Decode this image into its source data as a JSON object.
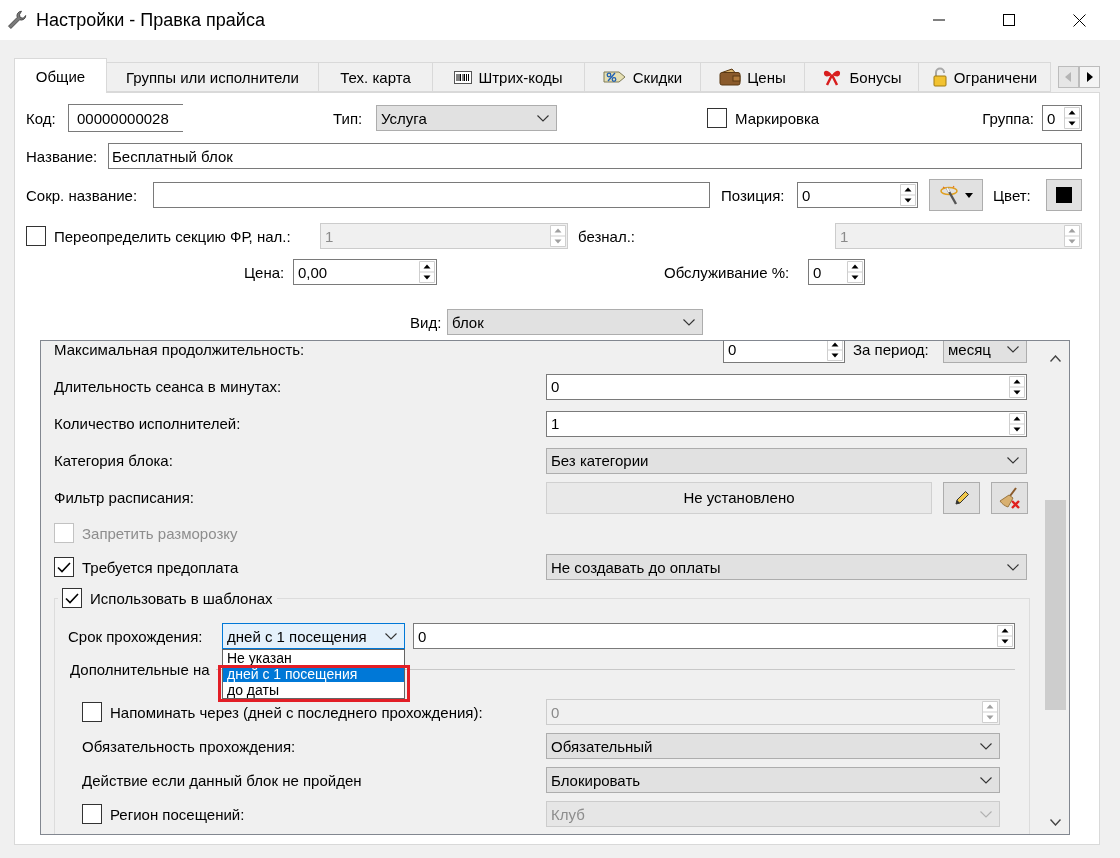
{
  "window": {
    "title": "Настройки - Правка прайса"
  },
  "tabs": [
    {
      "label": "Общие",
      "selected": true
    },
    {
      "label": "Группы или исполнители",
      "selected": false
    },
    {
      "label": "Тех. карта",
      "selected": false
    },
    {
      "label": "Штрих-коды",
      "selected": false
    },
    {
      "label": "Скидки",
      "selected": false
    },
    {
      "label": "Цены",
      "selected": false
    },
    {
      "label": "Бонусы",
      "selected": false
    },
    {
      "label": "Ограничени",
      "selected": false
    }
  ],
  "tab_scroll": {
    "back_disabled": true,
    "forward_disabled": false
  },
  "general": {
    "code": {
      "label": "Код:",
      "value": "00000000028"
    },
    "type": {
      "label": "Тип:",
      "value": "Услуга"
    },
    "marking": {
      "label": "Маркировка",
      "checked": false
    },
    "group": {
      "label": "Группа:",
      "value": "0"
    },
    "name": {
      "label": "Название:",
      "value": "Бесплатный блок"
    },
    "short_name": {
      "label": "Сокр. название:"
    },
    "position": {
      "label": "Позиция:",
      "value": "0"
    },
    "color": {
      "label": "Цвет:",
      "color": "#000000"
    },
    "override_fr": {
      "label": "Переопределить секцию ФР, нал.:",
      "checked": false,
      "value": "1",
      "disabled": true
    },
    "cashless": {
      "label": "безнал.:",
      "value": "1",
      "disabled": true
    },
    "price": {
      "label": "Цена:",
      "value": "0,00"
    },
    "service": {
      "label": "Обслуживание %:",
      "value": "0"
    },
    "view": {
      "label": "Вид:",
      "value": "блок"
    }
  },
  "block": {
    "rows": [
      {
        "kind": "spin_period",
        "label": "Максимальная продолжительность:",
        "value": "0",
        "period_label": "За период:",
        "period_value": "месяц"
      },
      {
        "kind": "spin",
        "label": "Длительность сеанса в минутах:",
        "value": "0"
      },
      {
        "kind": "spin",
        "label": "Количество исполнителей:",
        "value": "1"
      },
      {
        "kind": "combo",
        "label": "Категория блока:",
        "value": "Без категории"
      },
      {
        "kind": "filter",
        "label": "Фильтр расписания:",
        "value": "Не установлено"
      },
      {
        "kind": "check",
        "label": "Запретить разморозку",
        "checked": false,
        "disabled": true
      },
      {
        "kind": "check_combo",
        "label": "Требуется предоплата",
        "checked": true,
        "value": "Не создавать до оплаты"
      }
    ],
    "templates": {
      "label": "Использовать в шаблонах",
      "checked": true,
      "term": {
        "label": "Срок прохождения:",
        "value": "дней с 1 посещения",
        "expanded": true,
        "options": [
          {
            "label": "Не указан",
            "selected": false
          },
          {
            "label": "дней с 1 посещения",
            "selected": true
          },
          {
            "label": "до даты",
            "selected": false
          }
        ],
        "days": "0"
      },
      "section_title": "Дополнительные на",
      "rows": [
        {
          "kind": "check_spin",
          "label": "Напоминать через (дней с последнего прохождения):",
          "checked": false,
          "value": "0",
          "disabled": true
        },
        {
          "kind": "combo",
          "label": "Обязательность прохождения:",
          "value": "Обязательный"
        },
        {
          "kind": "combo",
          "label": "Действие если данный блок не пройден",
          "value": "Блокировать"
        },
        {
          "kind": "check_combo",
          "label": "Регион посещений:",
          "checked": false,
          "value": "Клуб",
          "disabled": true
        }
      ]
    }
  }
}
